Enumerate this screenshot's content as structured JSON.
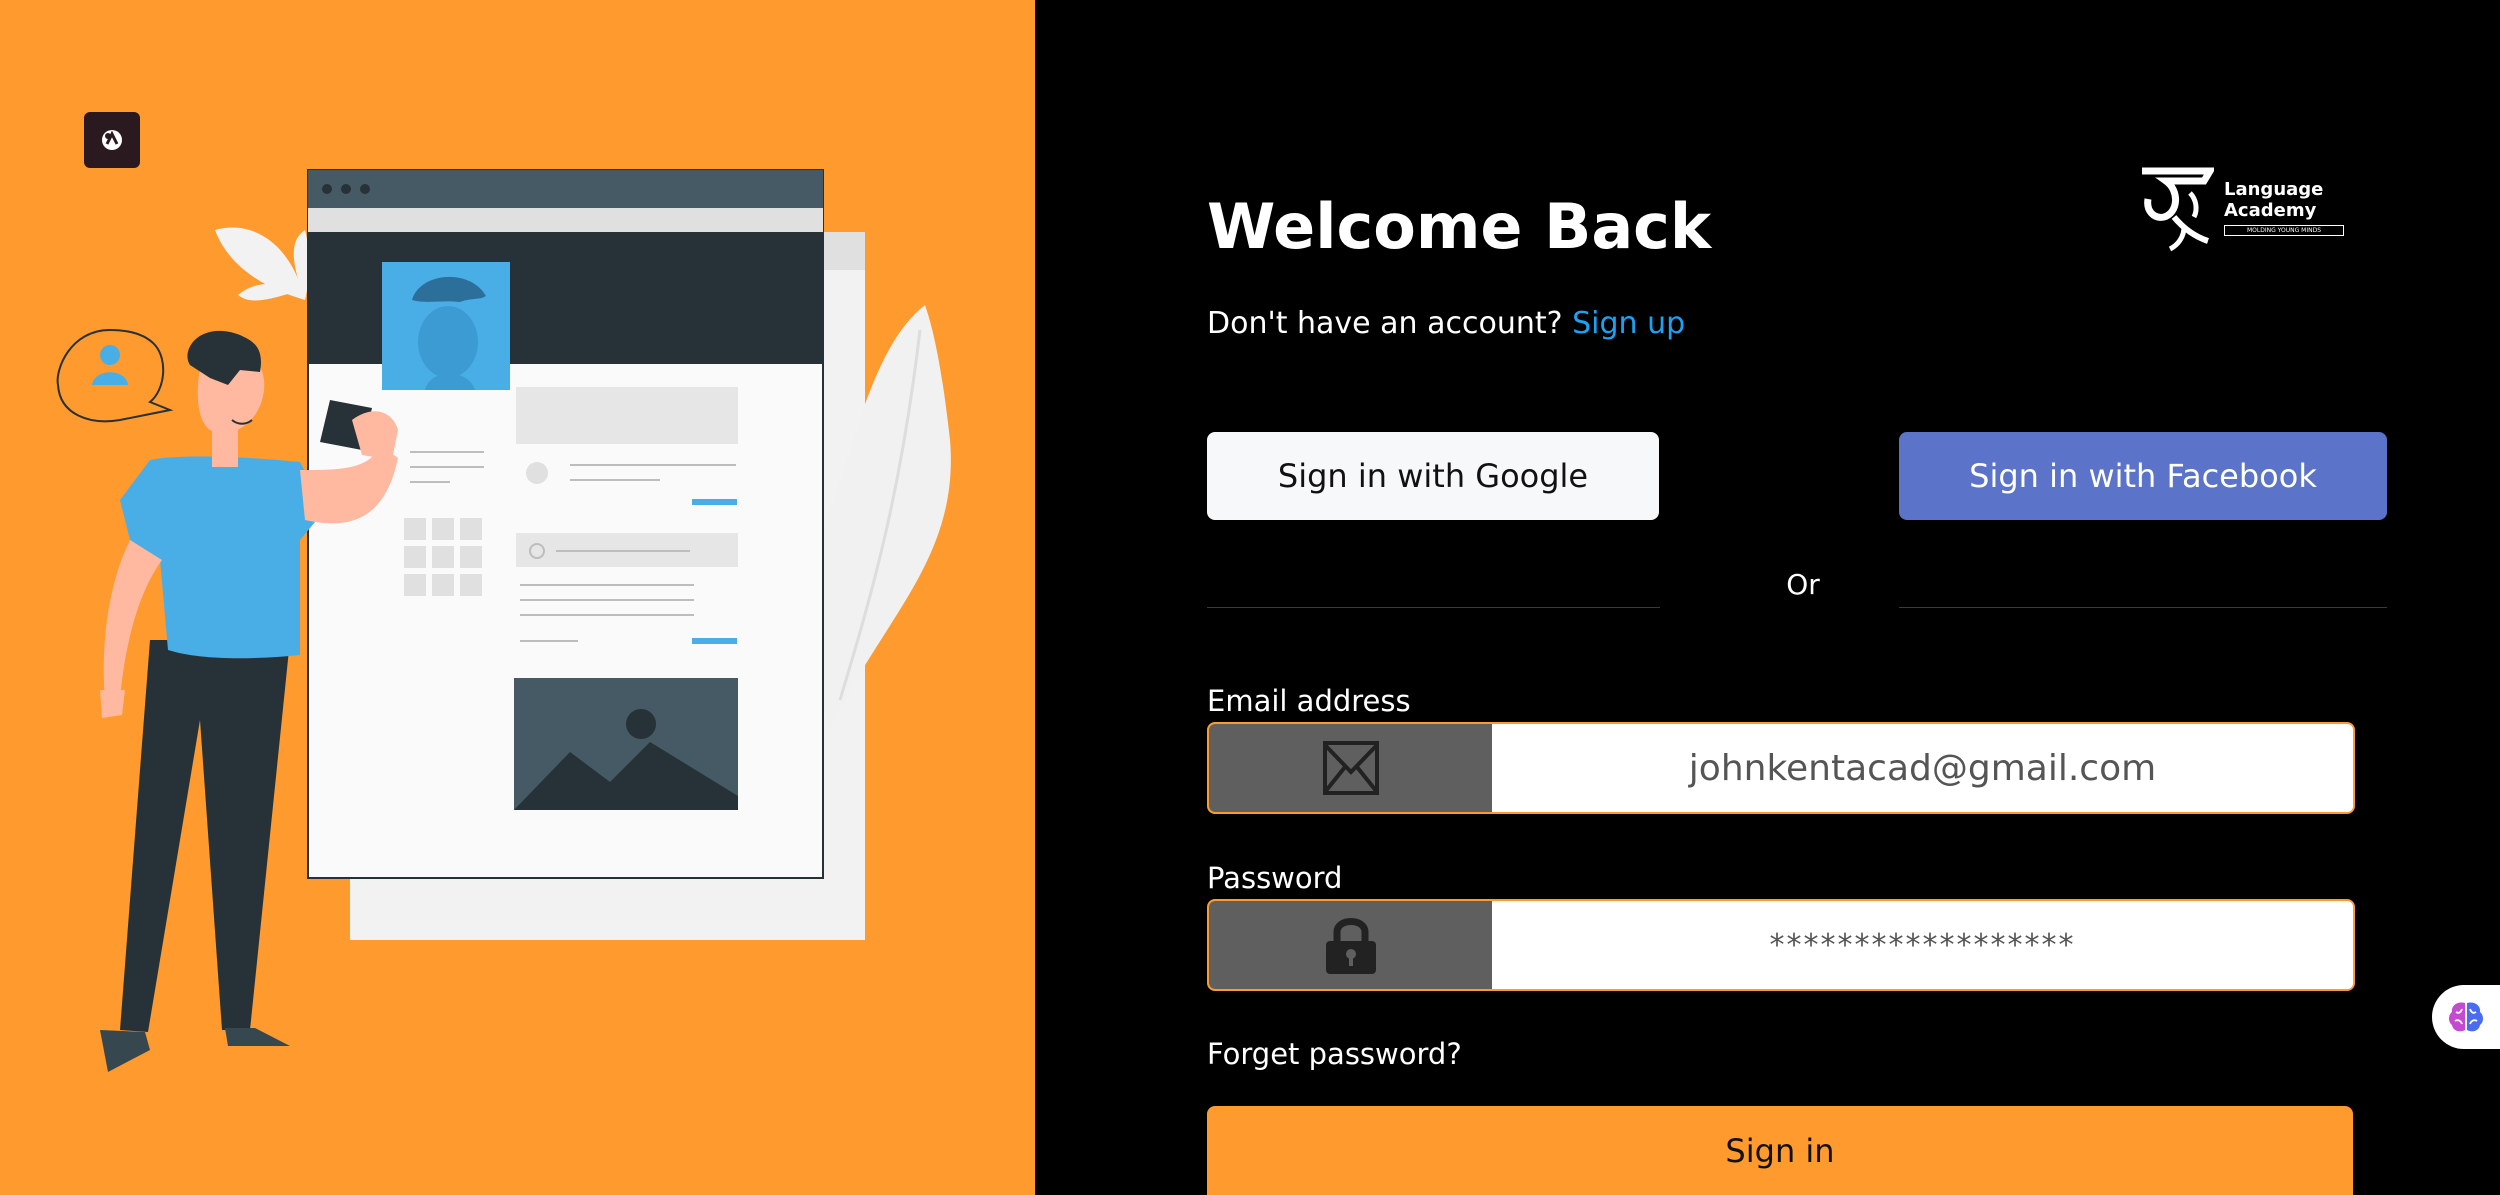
{
  "login": {
    "title": "Welcome Back",
    "no_account_text": "Don't have an account?",
    "signup_link": "Sign up",
    "google_button": "Sign in with Google",
    "facebook_button": "Sign in with Facebook",
    "divider_text": "Or",
    "email_label": "Email address",
    "email_value": "johnkentacad@gmail.com",
    "password_label": "Password",
    "password_value": "******************",
    "forget_password": "Forget password?",
    "signin_button": "Sign in"
  },
  "logo": {
    "line1": "Language",
    "line2": "Academy",
    "tagline": "MOLDING YOUNG MINDS",
    "icon": "language-academy-logo"
  },
  "icons": {
    "app": "app-icon",
    "email": "envelope-icon",
    "password": "lock-icon",
    "assistant": "brain-icon"
  },
  "colors": {
    "accent_orange": "#ff9a2e",
    "facebook_blue": "#5b73c9",
    "link_blue": "#1da1f2",
    "field_icon_bg": "#5f5f5f"
  }
}
